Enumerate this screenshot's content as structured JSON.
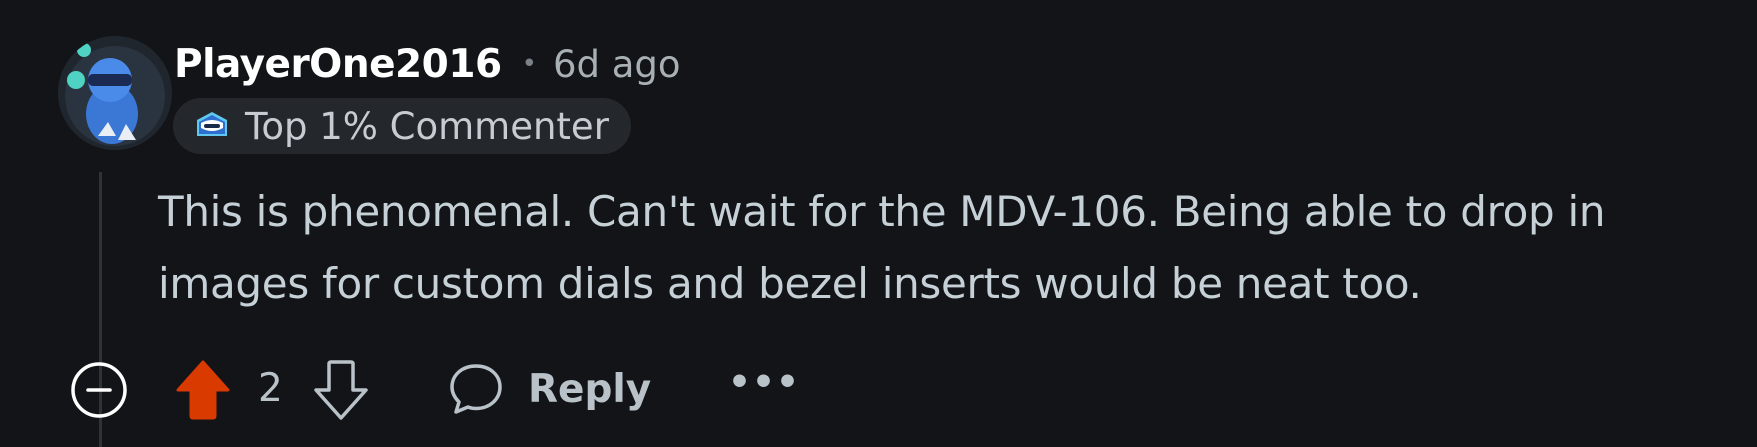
{
  "comment": {
    "author": "PlayerOne2016",
    "separator": "•",
    "timestamp": "6d ago",
    "flair": "Top 1% Commenter",
    "body": [
      "This is phenomenal. Can't wait for the MDV-106. Being able to drop in",
      "images for custom dials and bezel inserts would be neat too."
    ]
  },
  "actions": {
    "score": "2",
    "reply_label": "Reply",
    "more_label": "•••"
  },
  "colors": {
    "background": "#121417",
    "upvote_active": "#d93a00",
    "text": "#c6d0d7"
  },
  "icons": [
    "avatar",
    "commenter-badge-icon",
    "collapse-icon",
    "upvote-icon",
    "downvote-icon",
    "reply-icon",
    "more-icon"
  ]
}
